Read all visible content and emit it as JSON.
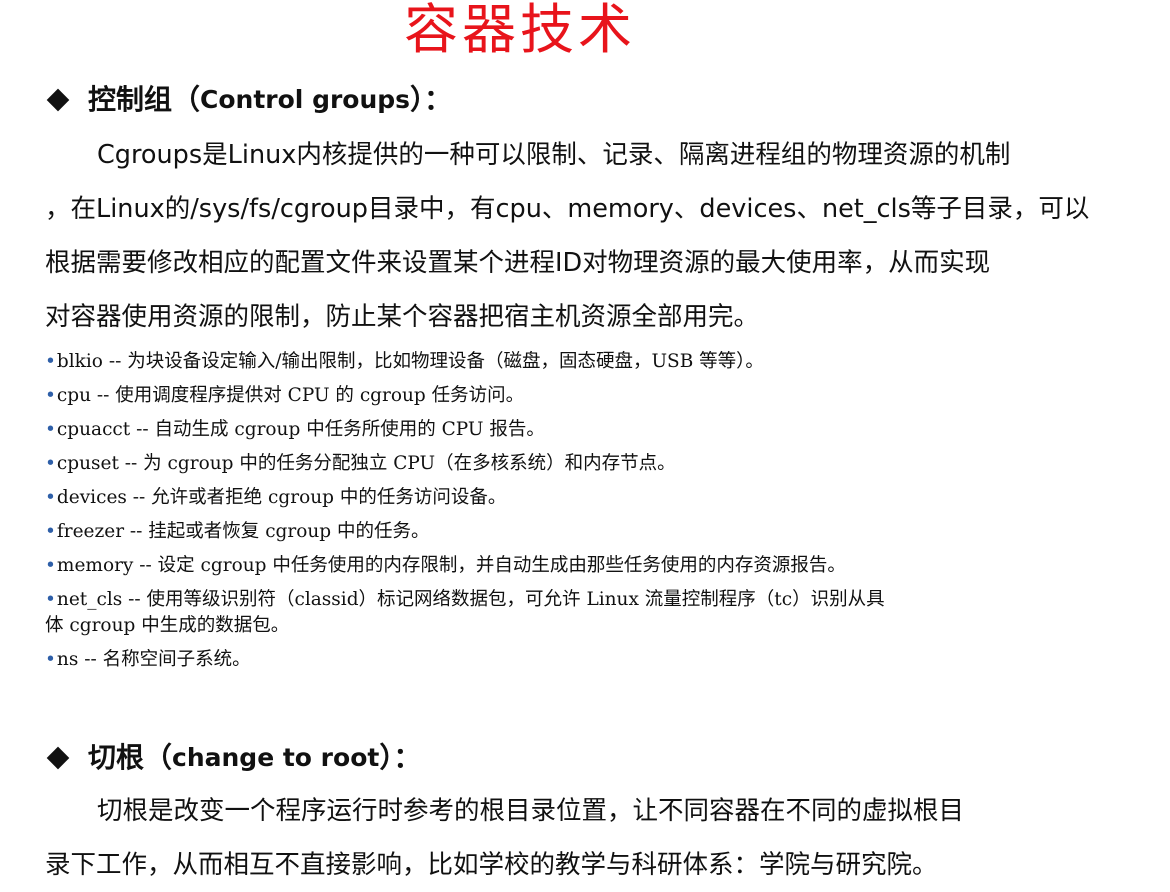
{
  "title": "容器技术",
  "section1": {
    "heading": "控制组（",
    "heading_en": "Control groups",
    "heading_tail": "）：",
    "paragraph_lines": [
      "Cgroups是Linux内核提供的一种可以限制、记录、隔离进程组的物理资源的机制",
      "，在Linux的/sys/fs/cgroup目录中，有cpu、memory、devices、net_cls等子目录，可以",
      "根据需要修改相应的配置文件来设置某个进程ID对物理资源的最大使用率，从而实现",
      "对容器使用资源的限制，防止某个容器把宿主机资源全部用完。"
    ],
    "bullet_marker": "•",
    "bullets": [
      "blkio -- 为块设备设定输入/输出限制，比如物理设备（磁盘，固态硬盘，USB 等等）。",
      "cpu -- 使用调度程序提供对 CPU 的 cgroup 任务访问。",
      "cpuacct -- 自动生成 cgroup 中任务所使用的 CPU 报告。",
      "cpuset -- 为 cgroup 中的任务分配独立 CPU（在多核系统）和内存节点。",
      "devices -- 允许或者拒绝 cgroup 中的任务访问设备。",
      "freezer -- 挂起或者恢复 cgroup 中的任务。",
      "memory -- 设定 cgroup 中任务使用的内存限制，并自动生成由那些任务使用的内存资源报告。",
      "net_cls -- 使用等级识别符（classid）标记网络数据包，可允许 Linux 流量控制程序（tc）识别从具",
      "ns -- 名称空间子系统。"
    ],
    "bullet_net_cls_continuation": "体 cgroup 中生成的数据包。"
  },
  "section2": {
    "heading": "切根（",
    "heading_en": "change to root",
    "heading_tail": "）：",
    "paragraph_lines": [
      "切根是改变一个程序运行时参考的根目录位置，让不同容器在不同的虚拟根目",
      "录下工作，从而相互不直接影响，比如学校的教学与科研体系：学院与研究院。"
    ]
  },
  "colors": {
    "title": "#e8141b",
    "text": "#111111",
    "bullet_dot": "#2e5fa8"
  },
  "icons": {
    "heading_marker": "diamond-bullet-icon"
  }
}
